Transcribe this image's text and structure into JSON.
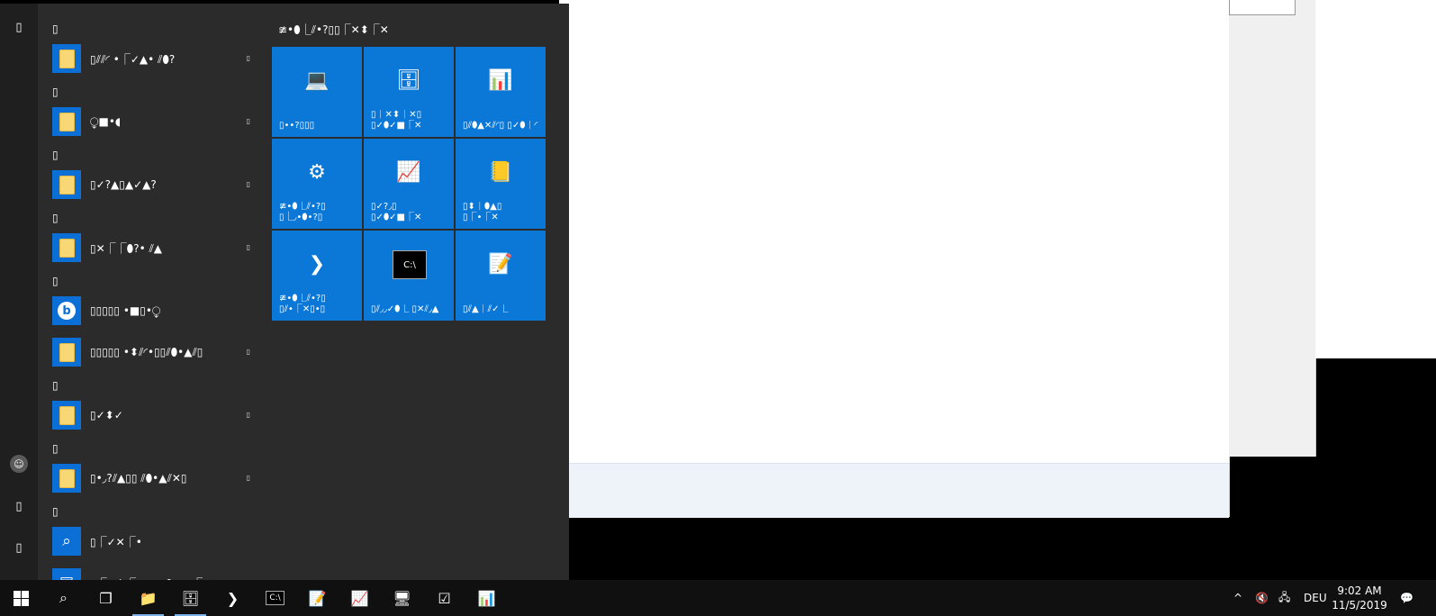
{
  "start_menu": {
    "rail": {
      "expand_glyph": "▯",
      "user_glyph": "☺",
      "documents_glyph": "▯",
      "pictures_glyph": "▯"
    },
    "app_list": [
      {
        "kind": "letter",
        "text": "▯"
      },
      {
        "kind": "app",
        "icon": "folder",
        "label": "▯⫽⫽◜ •⎾✓▲• ⫽⬮?",
        "has_chevron": true
      },
      {
        "kind": "letter",
        "text": "▯"
      },
      {
        "kind": "app",
        "icon": "folder",
        "label": "⧬■•◖",
        "has_chevron": true
      },
      {
        "kind": "letter",
        "text": "▯"
      },
      {
        "kind": "app",
        "icon": "folder",
        "label": "▯✓?▲▯▲✓▲?",
        "has_chevron": true
      },
      {
        "kind": "letter",
        "text": "▯"
      },
      {
        "kind": "app",
        "icon": "folder",
        "label": "▯✕⎾⎾⬮?• ⫽▲",
        "has_chevron": true
      },
      {
        "kind": "letter",
        "text": "▯"
      },
      {
        "kind": "app",
        "icon": "circle",
        "label": "▯▯▯▯▯ •■▯•⧬",
        "has_chevron": false
      },
      {
        "kind": "app",
        "icon": "folder",
        "label": "▯▯▯▯▯ •⬍⫽◜•▯▯⫽⬮•▲⫽▯",
        "has_chevron": true
      },
      {
        "kind": "letter",
        "text": "▯"
      },
      {
        "kind": "app",
        "icon": "folder",
        "label": "▯✓⬍✓",
        "has_chevron": true
      },
      {
        "kind": "letter",
        "text": "▯"
      },
      {
        "kind": "app",
        "icon": "folder",
        "label": "▯•◞?⫽▲▯▯ ⫽⬮•▲⫽✕▯",
        "has_chevron": true
      },
      {
        "kind": "letter",
        "text": "▯"
      },
      {
        "kind": "app",
        "icon": "search",
        "label": "▯⎾✓✕⎾•",
        "has_chevron": false
      },
      {
        "kind": "app",
        "icon": "server",
        "label": "▯⎾✕⬍⎾✕▯▯✓⬮✓■⎾✕",
        "has_chevron": false
      }
    ],
    "tiles_header": "≇•⬮⎿⫽•?▯▯⎾✕⬍⎾✕",
    "tiles": [
      {
        "glyph": "💻",
        "icon_name": "computer-icon",
        "label": "▯••?▯▯▯"
      },
      {
        "glyph": "🗄",
        "icon_name": "server-manager-icon",
        "label": "▯⎾✕⬍⎾✕▯ ▯✓⬮✓■⎾✕"
      },
      {
        "glyph": "📊",
        "icon_name": "control-panel-icon",
        "label": "▯⫽⬮▲✕⫽◜▯ ▯✓⬮⎾◜"
      },
      {
        "glyph": "⚙",
        "icon_name": "admin-tools-icon",
        "label": "≇•⬮⎿⫽•?▯ ▯⎿◞•⬮•?▯"
      },
      {
        "glyph": "📈",
        "icon_name": "task-manager-icon",
        "label": "▯✓?◞▯ ▯✓⬮✓■⎾✕"
      },
      {
        "glyph": "📒",
        "icon_name": "event-viewer-icon",
        "label": "▯⬍⎾⬮▲▯ ▯⎾•⎾✕"
      },
      {
        "glyph": "❯",
        "icon_name": "powershell-icon",
        "label": "≇•⬮⎿⫽•?▯ ▯⫽•⎾✕▯•▯"
      },
      {
        "glyph": "C:\\",
        "icon_name": "command-prompt-icon",
        "label": "▯⫽◞◞✓⬮⎿ ▯✕⫽◞▲"
      },
      {
        "glyph": "📝",
        "icon_name": "notepad-icon",
        "label": "▯⫽▲⎾⫽✓⎿"
      }
    ]
  },
  "taskbar": {
    "start_glyph": "⊞",
    "search_glyph": "⌕",
    "task_view_glyph": "❐",
    "pinned": [
      {
        "name": "file-explorer-icon",
        "glyph": "📁",
        "active": true
      },
      {
        "name": "server-manager-icon",
        "glyph": "🗄",
        "active": true
      },
      {
        "name": "powershell-icon",
        "glyph": "❯",
        "active": false
      },
      {
        "name": "command-prompt-icon",
        "glyph": "C:\\",
        "active": false
      },
      {
        "name": "notepad-icon",
        "glyph": "📝",
        "active": false
      },
      {
        "name": "performance-monitor-icon",
        "glyph": "📈",
        "active": false
      },
      {
        "name": "hyper-v-icon",
        "glyph": "🖥",
        "active": false
      },
      {
        "name": "task-list-icon",
        "glyph": "☑",
        "active": false
      },
      {
        "name": "control-panel-icon",
        "glyph": "📊",
        "active": false
      }
    ],
    "tray": {
      "chevron": "^",
      "volume_glyph": "🔇",
      "network_glyph": "🖧",
      "language": "DEU",
      "time": "9:02 AM",
      "date": "11/5/2019",
      "notifications_glyph": "💬"
    }
  },
  "colors": {
    "tile_blue": "#0b78d8",
    "menu_bg": "#2b2b2b",
    "taskbar_bg": "#101010"
  }
}
